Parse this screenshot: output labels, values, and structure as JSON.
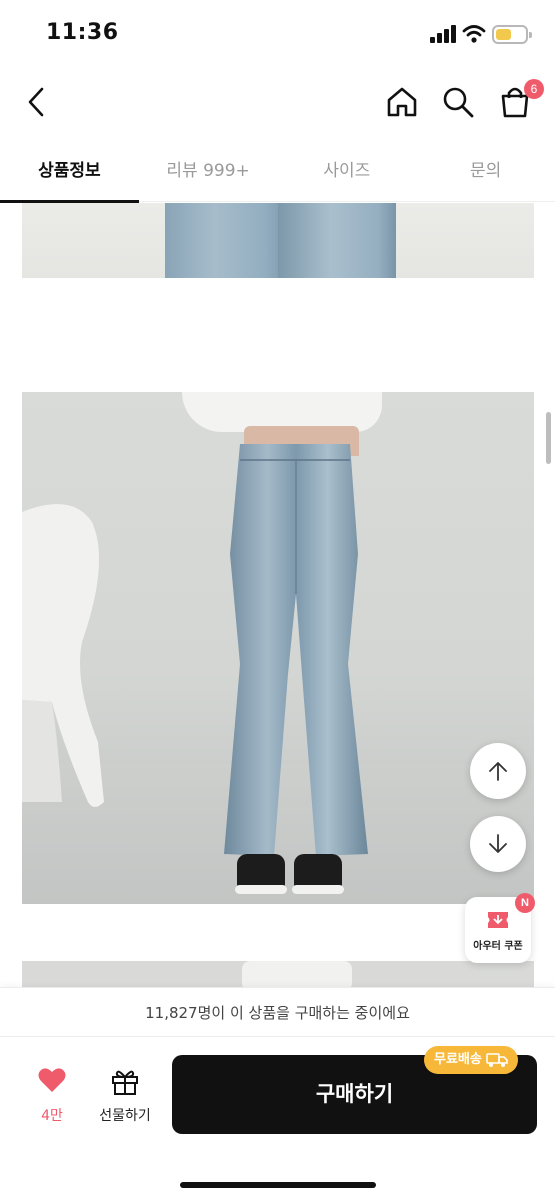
{
  "status_bar": {
    "time": "11:36"
  },
  "header": {
    "cart_count": "6"
  },
  "tabs": [
    {
      "label": "상품정보",
      "active": true
    },
    {
      "label": "리뷰 999+",
      "active": false
    },
    {
      "label": "사이즈",
      "active": false
    },
    {
      "label": "문의",
      "active": false
    }
  ],
  "floating": {
    "coupon_label": "아우터 쿠폰",
    "coupon_badge": "N"
  },
  "bottom": {
    "buyers_text": "11,827명이 이 상품을 구매하는 중이에요",
    "like_count": "4만",
    "gift_label": "선물하기",
    "buy_label": "구매하기",
    "free_shipping_label": "무료배송"
  },
  "colors": {
    "accent_red": "#f05b6c",
    "buy_button": "#111111",
    "free_shipping": "#f7b83a",
    "battery": "#f2c94c"
  },
  "icons": [
    "back-icon",
    "home-icon",
    "search-icon",
    "cart-icon",
    "arrow-up-icon",
    "arrow-down-icon",
    "coupon-icon",
    "heart-icon",
    "gift-icon",
    "truck-icon"
  ]
}
